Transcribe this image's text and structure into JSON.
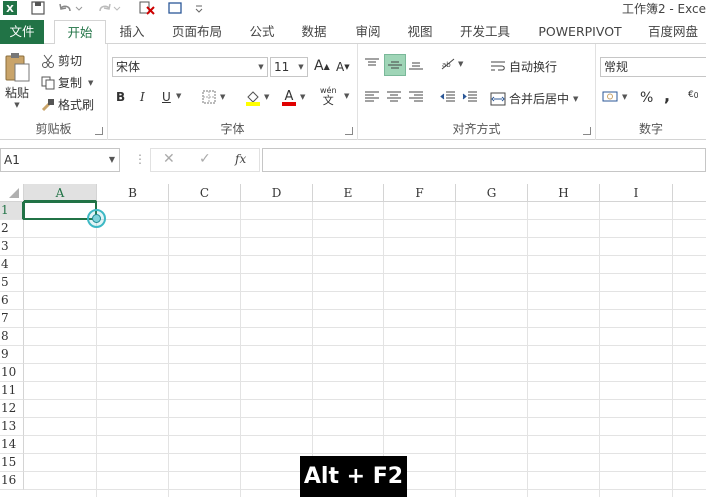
{
  "window": {
    "title": "工作簿2 - Exce"
  },
  "tabs": [
    {
      "label": "文件"
    },
    {
      "label": "开始"
    },
    {
      "label": "插入"
    },
    {
      "label": "页面布局"
    },
    {
      "label": "公式"
    },
    {
      "label": "数据"
    },
    {
      "label": "审阅"
    },
    {
      "label": "视图"
    },
    {
      "label": "开发工具"
    },
    {
      "label": "POWERPIVOT"
    },
    {
      "label": "百度网盘"
    }
  ],
  "clipboard": {
    "paste": "粘贴",
    "cut": "剪切",
    "copy": "复制",
    "format_painter": "格式刷",
    "label": "剪贴板"
  },
  "font": {
    "name": "宋体",
    "size": "11",
    "bold": "B",
    "italic": "I",
    "underline": "U",
    "phonetic": "wén",
    "label": "字体"
  },
  "alignment": {
    "wrap_text": "自动换行",
    "merge_center": "合并后居中",
    "label": "对齐方式"
  },
  "number": {
    "format": "常规",
    "percent": "%",
    "comma": ",",
    "label": "数字"
  },
  "formula_bar": {
    "cell_ref": "A1",
    "fx": "fx",
    "value": ""
  },
  "grid": {
    "columns": [
      "A",
      "B",
      "C",
      "D",
      "E",
      "F",
      "G",
      "H",
      "I"
    ],
    "rows": [
      "1",
      "2",
      "3",
      "4",
      "5",
      "6",
      "7",
      "8",
      "9",
      "10",
      "11",
      "12",
      "13",
      "14",
      "15",
      "16"
    ],
    "active_cell": "A1"
  },
  "key_overlay": "Alt + F2",
  "colors": {
    "accent": "#217346",
    "highlight": "#ffff00",
    "font_color": "#e00000"
  }
}
